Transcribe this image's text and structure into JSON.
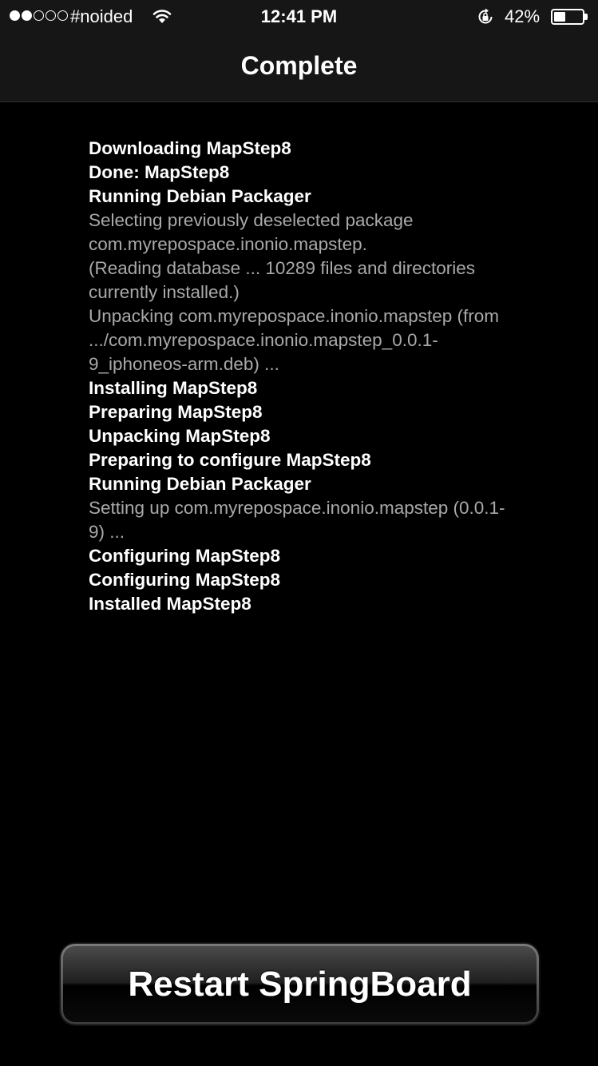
{
  "status_bar": {
    "signal_filled": 2,
    "signal_total": 5,
    "carrier": "#noided",
    "time": "12:41 PM",
    "battery_percent_label": "42%",
    "battery_level": 0.42
  },
  "nav": {
    "title": "Complete"
  },
  "log": [
    {
      "text": "Downloading MapStep8",
      "style": "bold"
    },
    {
      "text": "Done: MapStep8",
      "style": "bold"
    },
    {
      "text": "Running Debian Packager",
      "style": "bold"
    },
    {
      "text": "Selecting previously deselected package",
      "style": "dim"
    },
    {
      "text": "com.myrepospace.inonio.mapstep.",
      "style": "dim"
    },
    {
      "text": "(Reading database ... 10289 files and directories",
      "style": "dim"
    },
    {
      "text": "currently installed.)",
      "style": "dim"
    },
    {
      "text": "Unpacking com.myrepospace.inonio.mapstep (from",
      "style": "dim"
    },
    {
      "text": ".../com.myrepospace.inonio.mapstep_0.0.1-",
      "style": "dim"
    },
    {
      "text": "9_iphoneos-arm.deb) ...",
      "style": "dim"
    },
    {
      "text": "Installing MapStep8",
      "style": "bold"
    },
    {
      "text": "Preparing MapStep8",
      "style": "bold"
    },
    {
      "text": "Unpacking MapStep8",
      "style": "bold"
    },
    {
      "text": "Preparing to configure MapStep8",
      "style": "bold"
    },
    {
      "text": "Running Debian Packager",
      "style": "bold"
    },
    {
      "text": "Setting up com.myrepospace.inonio.mapstep (0.0.1-",
      "style": "dim"
    },
    {
      "text": "9) ...",
      "style": "dim"
    },
    {
      "text": "Configuring MapStep8",
      "style": "bold"
    },
    {
      "text": "Configuring MapStep8",
      "style": "bold"
    },
    {
      "text": "Installed MapStep8",
      "style": "bold"
    }
  ],
  "button": {
    "label": "Restart SpringBoard"
  },
  "icons": {
    "signal": "signal-dots-icon",
    "wifi": "wifi-icon",
    "lock": "rotation-lock-icon",
    "battery": "battery-icon"
  },
  "colors": {
    "background": "#000000",
    "header_bg": "#161616",
    "log_bold": "#ffffff",
    "log_dim": "#a9a9a9"
  }
}
